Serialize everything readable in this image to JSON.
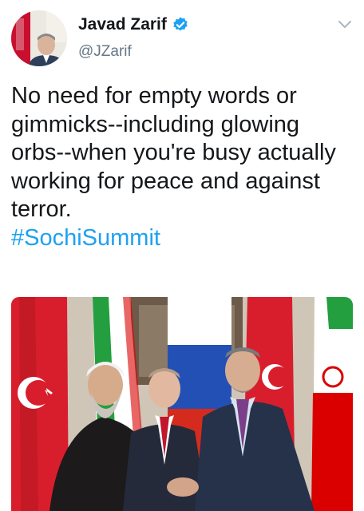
{
  "author": {
    "display_name": "Javad Zarif",
    "handle": "@JZarif",
    "verified": true,
    "verified_icon": "verified-badge-icon"
  },
  "menu": {
    "icon": "chevron-down-icon"
  },
  "tweet": {
    "text": "No need for empty words or gimmicks--including glowing orbs--when you're busy actually working for peace and against terror.",
    "hashtag": "#SochiSummit"
  },
  "media": {
    "description": "photo"
  },
  "colors": {
    "link": "#1da1f2",
    "verified": "#1da1f2",
    "muted": "#657786"
  }
}
